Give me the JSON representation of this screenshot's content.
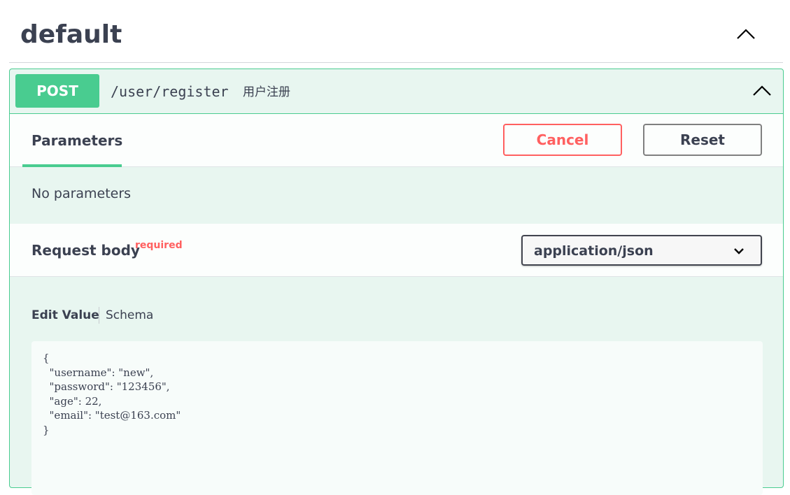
{
  "tag": {
    "name": "default",
    "collapse_icon": "chevron-up-icon"
  },
  "operation": {
    "method": "POST",
    "path": "/user/register",
    "summary": "用户注册",
    "collapse_icon": "chevron-up-icon",
    "colors": {
      "method": "#49cc90",
      "background": "#e8f6f0",
      "border": "#49cc90"
    }
  },
  "parameters": {
    "tab_label": "Parameters",
    "cancel_label": "Cancel",
    "reset_label": "Reset",
    "empty_text": "No parameters"
  },
  "request_body": {
    "title": "Request body",
    "required_label": "required",
    "content_type": "application/json",
    "select_icon": "chevron-down-icon",
    "tabs": {
      "edit_value": "Edit Value",
      "schema": "Schema"
    },
    "value": "{\n  \"username\": \"new\",\n  \"password\": \"123456\",\n  \"age\": 22,\n  \"email\": \"test@163.com\"\n}"
  }
}
